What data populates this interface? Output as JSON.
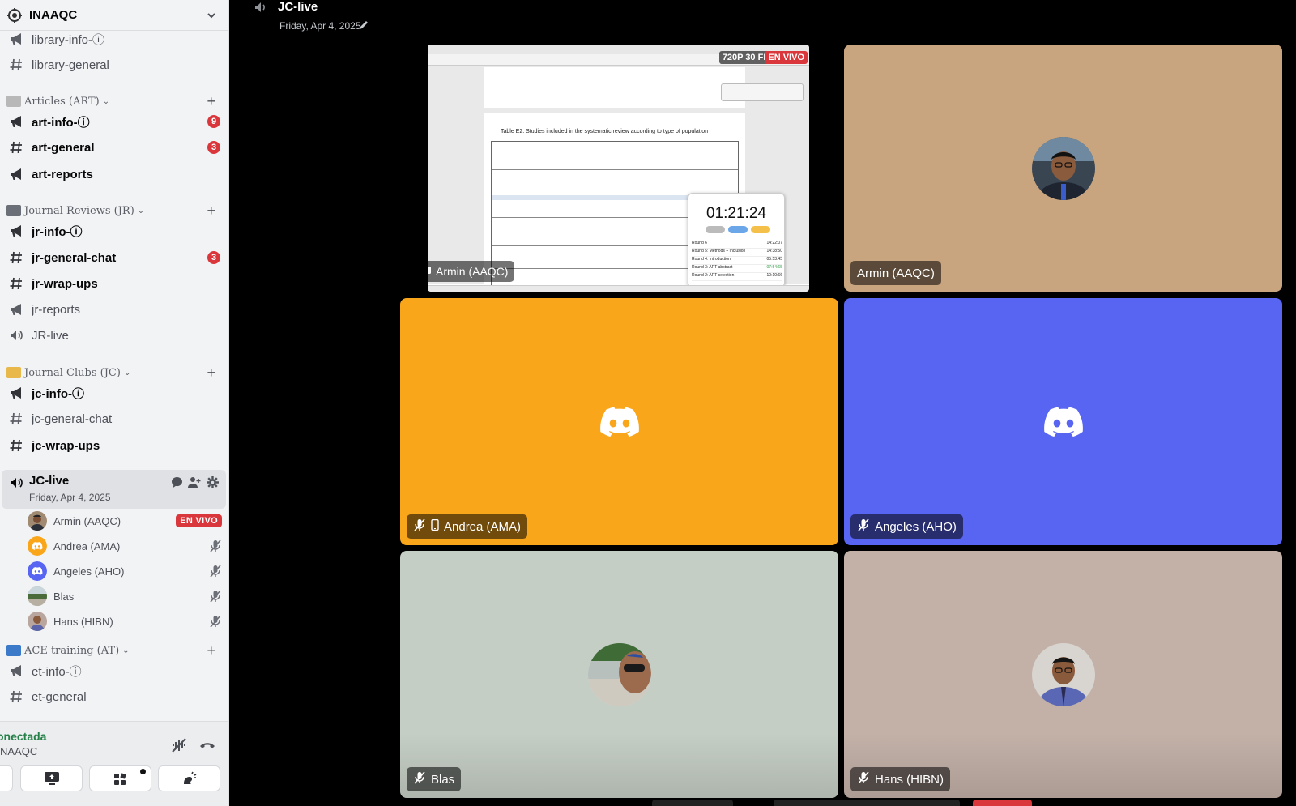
{
  "server": {
    "name": "INAAQC"
  },
  "channels_top": [
    {
      "name": "library-info-ⓘ",
      "type": "announcement",
      "bold": false
    },
    {
      "name": "library-general",
      "type": "text",
      "bold": false
    }
  ],
  "categories": [
    {
      "name": "Articles (ART)",
      "emoji_color": "#b8b8b8",
      "channels": [
        {
          "name": "art-info-ⓘ",
          "type": "announcement",
          "bold": true,
          "badge": "9"
        },
        {
          "name": "art-general",
          "type": "text",
          "bold": true,
          "badge": "3"
        },
        {
          "name": "art-reports",
          "type": "announcement",
          "bold": true,
          "badge": ""
        }
      ]
    },
    {
      "name": "Journal Reviews (JR)",
      "emoji_color": "#6a6f78",
      "channels": [
        {
          "name": "jr-info-ⓘ",
          "type": "announcement",
          "bold": true,
          "badge": ""
        },
        {
          "name": "jr-general-chat",
          "type": "text",
          "bold": true,
          "badge": "3"
        },
        {
          "name": "jr-wrap-ups",
          "type": "text",
          "bold": true,
          "badge": ""
        },
        {
          "name": "jr-reports",
          "type": "announcement",
          "bold": false,
          "badge": ""
        },
        {
          "name": "JR-live",
          "type": "voice",
          "bold": false,
          "badge": ""
        }
      ]
    },
    {
      "name": "Journal Clubs (JC)",
      "emoji_color": "#e8b84a",
      "channels": [
        {
          "name": "jc-info-ⓘ",
          "type": "announcement",
          "bold": true,
          "badge": ""
        },
        {
          "name": "jc-general-chat",
          "type": "text",
          "bold": false,
          "badge": ""
        },
        {
          "name": "jc-wrap-ups",
          "type": "text",
          "bold": true,
          "badge": ""
        }
      ]
    },
    {
      "name": "ACE training (AT)",
      "emoji_color": "#3b79c9",
      "channels": [
        {
          "name": "et-info-ⓘ",
          "type": "announcement",
          "bold": false,
          "badge": ""
        },
        {
          "name": "et-general",
          "type": "text",
          "bold": false,
          "badge": ""
        }
      ]
    }
  ],
  "active_voice": {
    "name": "JC-live",
    "date": "Friday, Apr 4, 2025",
    "members": [
      {
        "name": "Armin (AAQC)",
        "status": "EN VIVO",
        "avatar": "photo-man"
      },
      {
        "name": "Andrea (AMA)",
        "status": "muted",
        "avatar": "discord-orange"
      },
      {
        "name": "Angeles (AHO)",
        "status": "muted",
        "avatar": "discord-blurple"
      },
      {
        "name": "Blas",
        "status": "muted",
        "avatar": "photo-landscape"
      },
      {
        "name": "Hans (HIBN)",
        "status": "muted",
        "avatar": "photo-man-2"
      }
    ]
  },
  "voice_panel": {
    "status": "onectada",
    "server": "NAAQC"
  },
  "stage": {
    "title": "JC-live",
    "date": "Friday, Apr 4, 2025",
    "share": {
      "fps_label": "720P 30 FPS",
      "live_label": "EN VIVO",
      "owner": "Armin (AAQC)",
      "doc_title": "Table E2. Studies included in the systematic review according to type of population",
      "timer": "01:21:24",
      "rounds": [
        {
          "label": "Round 6",
          "time": "14:22:07"
        },
        {
          "label": "Round 5: Methods + Inclusion",
          "time": "14:38:50"
        },
        {
          "label": "Round 4: Introduction",
          "time": "05:53:45"
        },
        {
          "label": "Round 3: ART abstract",
          "time": "07:54:65"
        },
        {
          "label": "Round 2: ART selection",
          "time": "10:10:66"
        }
      ]
    },
    "tiles": [
      {
        "name": "Armin (AAQC)",
        "bg": "#c9a57f",
        "kind": "photo",
        "muted": false,
        "mobile": false
      },
      {
        "name": "Andrea (AMA)",
        "bg": "#faa61a",
        "kind": "discord",
        "muted": true,
        "mobile": true
      },
      {
        "name": "Angeles (AHO)",
        "bg": "#5865f2",
        "kind": "discord",
        "muted": true,
        "mobile": false
      },
      {
        "name": "Blas",
        "bg": "#c5cec5",
        "kind": "photo",
        "muted": true,
        "mobile": false
      },
      {
        "name": "Hans (HIBN)",
        "bg": "#c3b1a8",
        "kind": "photo",
        "muted": true,
        "mobile": false
      }
    ]
  },
  "colors": {
    "live_red": "#da373c",
    "connected_green": "#248046",
    "blurple": "#5865f2",
    "orange": "#faa61a"
  }
}
